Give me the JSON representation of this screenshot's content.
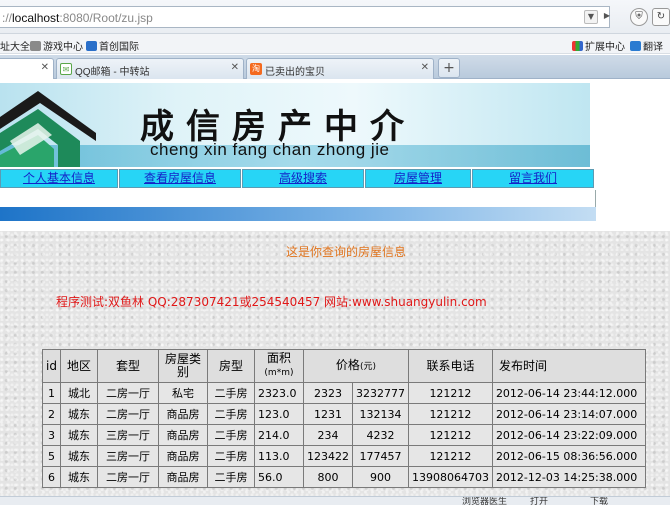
{
  "browser": {
    "address_host": "localhost",
    "address_rest": ":8080/Root/zu.jsp",
    "address_prefix": "://",
    "favorites": [
      "址大全",
      "游戏中心",
      "首创国际"
    ],
    "right_tools": [
      "扩展中心",
      "翻译"
    ],
    "tabs": [
      {
        "label": "",
        "active": true
      },
      {
        "label": "QQ邮箱 - 中转站",
        "active": false
      },
      {
        "label": "已卖出的宝贝",
        "active": false
      }
    ],
    "status_items": [
      "浏览器医生",
      "打开",
      "下载"
    ]
  },
  "banner": {
    "title": "成信房产中介",
    "subtitle": "cheng xin fang chan zhong jie"
  },
  "nav": {
    "items": [
      "个人基本信息",
      "查看房屋信息",
      "高级搜索",
      "房屋管理",
      "留言我们"
    ]
  },
  "main": {
    "result_title": "这是你查询的房屋信息",
    "credit": "程序测试:双鱼林 QQ:287307421或254540457 网站:www.shuangyulin.com"
  },
  "table": {
    "headers": {
      "id": "id",
      "district": "地区",
      "layout": "套型",
      "house_class": "房屋类别",
      "house_type": "房型",
      "area": "面积",
      "area_unit": "(m*m)",
      "price": "价格",
      "price_unit": "(元)",
      "phone": "联系电话",
      "time": "发布时间"
    },
    "rows": [
      {
        "id": "1",
        "district": "城北",
        "layout": "二房一厅",
        "house_class": "私宅",
        "house_type": "二手房",
        "area": "2323.0",
        "unit_price": "2323",
        "total_price": "3232777",
        "phone": "121212",
        "time": "2012-06-14 23:44:12.000"
      },
      {
        "id": "2",
        "district": "城东",
        "layout": "二房一厅",
        "house_class": "商品房",
        "house_type": "二手房",
        "area": "123.0",
        "unit_price": "1231",
        "total_price": "132134",
        "phone": "121212",
        "time": "2012-06-14 23:14:07.000"
      },
      {
        "id": "3",
        "district": "城东",
        "layout": "三房一厅",
        "house_class": "商品房",
        "house_type": "二手房",
        "area": "214.0",
        "unit_price": "234",
        "total_price": "4232",
        "phone": "121212",
        "time": "2012-06-14 23:22:09.000"
      },
      {
        "id": "5",
        "district": "城东",
        "layout": "三房一厅",
        "house_class": "商品房",
        "house_type": "二手房",
        "area": "113.0",
        "unit_price": "123422",
        "total_price": "177457",
        "phone": "121212",
        "time": "2012-06-15 08:36:56.000"
      },
      {
        "id": "6",
        "district": "城东",
        "layout": "二房一厅",
        "house_class": "商品房",
        "house_type": "二手房",
        "area": "56.0",
        "unit_price": "800",
        "total_price": "900",
        "phone": "13908064703",
        "time": "2012-12-03 14:25:38.000"
      }
    ]
  },
  "colors": {
    "nav_bg": "#27d5f6",
    "nav_link": "#1422c8",
    "result_title": "#e0751f",
    "credit": "#e01818"
  }
}
